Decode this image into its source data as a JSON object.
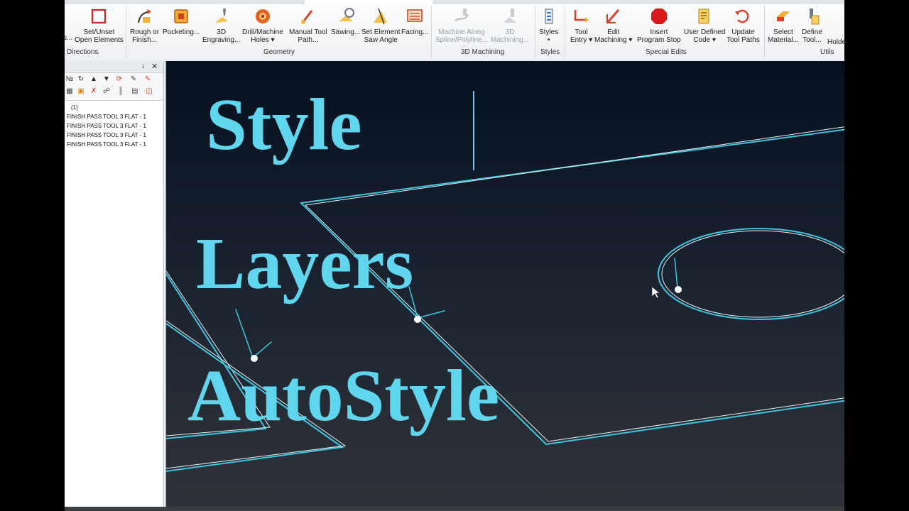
{
  "ribbon": {
    "buttons": {
      "set_unset": "Set/Unset",
      "open_elements": "Open Elements",
      "truncated_left": "s...",
      "rough_or": "Rough or",
      "finish": "Finish...",
      "pocketing": "Pocketing...",
      "engraving_1": "3D",
      "engraving_2": "Engraving...",
      "drill_1": "Drill/Machine",
      "drill_2": "Holes",
      "manual_1": "Manual Tool",
      "manual_2": "Path...",
      "sawing": "Sawing...",
      "saw_1": "Set Element",
      "saw_2": "Saw Angle",
      "facing": "Facing...",
      "along_1": "Machine Along",
      "along_2": "Spline/Polyline...",
      "machining3d_1": "3D",
      "machining3d_2": "Machining...",
      "styles_1": "Styles",
      "styles_2": "•",
      "entry_1": "Tool",
      "entry_2": "Entry",
      "edit_1": "Edit",
      "edit_2": "Machining",
      "stop_1": "Insert",
      "stop_2": "Program Stop",
      "code_1": "User Defined",
      "code_2": "Code",
      "update_1": "Update",
      "update_2": "Tool Paths",
      "material_1": "Select",
      "material_2": "Material...",
      "tool_1": "Define",
      "tool_2": "Tool...",
      "holder": "Holde"
    },
    "groups": {
      "directions": "Directions",
      "geometry": "Geometry",
      "machining3d": "3D Machining",
      "styles": "Styles",
      "special_edits": "Special Edits",
      "utils": "Utils"
    }
  },
  "panel": {
    "pin_icon": "↓",
    "close_icon": "✕",
    "root": "(1)",
    "rows": [
      "FINISH PASS   TOOL 3   FLAT - 1",
      "FINISH PASS   TOOL 3   FLAT - 1",
      "FINISH PASS   TOOL 3   FLAT - 1",
      "FINISH PASS   TOOL 3   FLAT - 1"
    ]
  },
  "overlay": {
    "line1": "Style",
    "line2": "Layers",
    "line3": "AutoStyle"
  },
  "colors": {
    "accent": "#5fd6ee",
    "geometry": "#3ec6de",
    "viewport_top": "#06101e",
    "viewport_bottom": "#303338"
  },
  "icons": [
    "set-unset-icon",
    "rough-finish-icon",
    "pocketing-icon",
    "engraving-icon",
    "drill-icon",
    "manual-toolpath-icon",
    "sawing-icon",
    "saw-angle-icon",
    "facing-icon",
    "machine-along-icon",
    "machining-3d-icon",
    "styles-icon",
    "tool-entry-icon",
    "edit-machining-icon",
    "program-stop-icon",
    "user-code-icon",
    "update-toolpaths-icon",
    "select-material-icon",
    "define-tool-icon"
  ]
}
